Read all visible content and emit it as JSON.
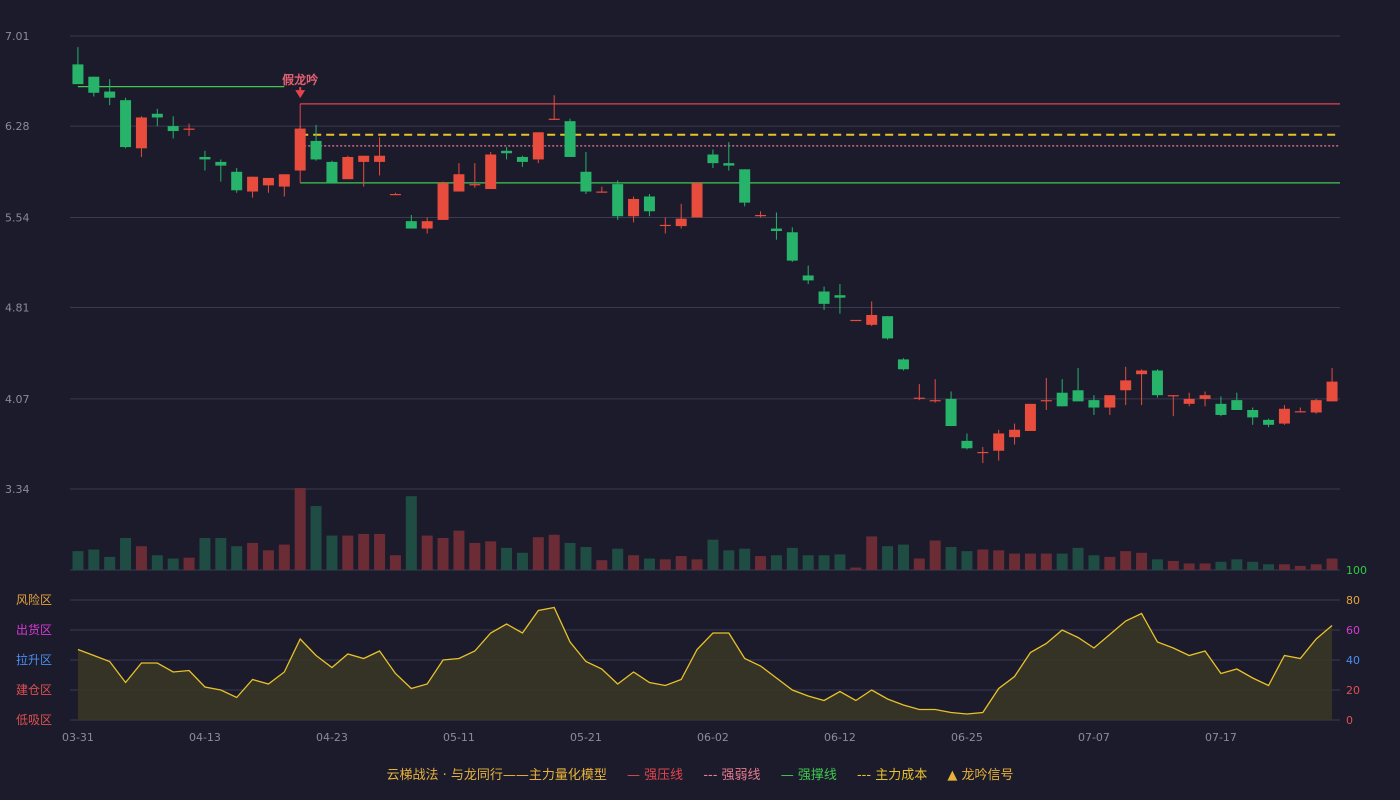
{
  "chart_data": {
    "type": "candlestick",
    "price_axis": {
      "ticks": [
        "7.01",
        "6.28",
        "5.54",
        "4.81",
        "4.07",
        "3.34"
      ],
      "ylim": [
        3.34,
        7.01
      ]
    },
    "x_ticks": [
      {
        "i": 0,
        "label": "03-31"
      },
      {
        "i": 8,
        "label": "04-13"
      },
      {
        "i": 16,
        "label": "04-23"
      },
      {
        "i": 24,
        "label": "05-11"
      },
      {
        "i": 32,
        "label": "05-21"
      },
      {
        "i": 40,
        "label": "06-02"
      },
      {
        "i": 48,
        "label": "06-12"
      },
      {
        "i": 56,
        "label": "06-25"
      },
      {
        "i": 64,
        "label": "07-07"
      },
      {
        "i": 72,
        "label": "07-17"
      }
    ],
    "candles": [
      {
        "o": 6.78,
        "h": 6.92,
        "l": 6.63,
        "c": 6.62
      },
      {
        "o": 6.68,
        "h": 6.68,
        "l": 6.52,
        "c": 6.55
      },
      {
        "o": 6.56,
        "h": 6.66,
        "l": 6.45,
        "c": 6.51
      },
      {
        "o": 6.49,
        "h": 6.51,
        "l": 6.1,
        "c": 6.11
      },
      {
        "o": 6.1,
        "h": 6.36,
        "l": 6.03,
        "c": 6.35
      },
      {
        "o": 6.38,
        "h": 6.42,
        "l": 6.28,
        "c": 6.35
      },
      {
        "o": 6.28,
        "h": 6.36,
        "l": 6.18,
        "c": 6.24
      },
      {
        "o": 6.25,
        "h": 6.3,
        "l": 6.2,
        "c": 6.26
      },
      {
        "o": 6.03,
        "h": 6.08,
        "l": 5.92,
        "c": 6.01
      },
      {
        "o": 5.99,
        "h": 6.01,
        "l": 5.83,
        "c": 5.96
      },
      {
        "o": 5.91,
        "h": 5.94,
        "l": 5.74,
        "c": 5.76
      },
      {
        "o": 5.75,
        "h": 5.87,
        "l": 5.7,
        "c": 5.87
      },
      {
        "o": 5.8,
        "h": 5.83,
        "l": 5.74,
        "c": 5.86
      },
      {
        "o": 5.79,
        "h": 5.84,
        "l": 5.71,
        "c": 5.89
      },
      {
        "o": 5.92,
        "h": 6.28,
        "l": 5.92,
        "c": 6.26
      },
      {
        "o": 6.16,
        "h": 6.29,
        "l": 6.0,
        "c": 6.01
      },
      {
        "o": 5.99,
        "h": 6.0,
        "l": 5.82,
        "c": 5.82
      },
      {
        "o": 5.85,
        "h": 6.04,
        "l": 5.85,
        "c": 6.03
      },
      {
        "o": 5.99,
        "h": 6.03,
        "l": 5.79,
        "c": 6.04
      },
      {
        "o": 5.99,
        "h": 6.19,
        "l": 5.88,
        "c": 6.04
      },
      {
        "o": 5.73,
        "h": 5.74,
        "l": 5.73,
        "c": 5.73
      },
      {
        "o": 5.51,
        "h": 5.56,
        "l": 5.49,
        "c": 5.45
      },
      {
        "o": 5.45,
        "h": 5.54,
        "l": 5.41,
        "c": 5.51
      },
      {
        "o": 5.52,
        "h": 5.83,
        "l": 5.52,
        "c": 5.82
      },
      {
        "o": 5.75,
        "h": 5.98,
        "l": 5.75,
        "c": 5.89
      },
      {
        "o": 5.8,
        "h": 5.98,
        "l": 5.78,
        "c": 5.81
      },
      {
        "o": 5.77,
        "h": 6.07,
        "l": 5.77,
        "c": 6.05
      },
      {
        "o": 6.08,
        "h": 6.11,
        "l": 6.01,
        "c": 6.06
      },
      {
        "o": 6.03,
        "h": 6.04,
        "l": 5.95,
        "c": 5.99
      },
      {
        "o": 6.01,
        "h": 6.01,
        "l": 5.98,
        "c": 6.23
      },
      {
        "o": 6.34,
        "h": 6.53,
        "l": 6.33,
        "c": 6.34
      },
      {
        "o": 6.32,
        "h": 6.34,
        "l": 6.03,
        "c": 6.03
      },
      {
        "o": 5.91,
        "h": 6.07,
        "l": 5.73,
        "c": 5.75
      },
      {
        "o": 5.75,
        "h": 5.79,
        "l": 5.75,
        "c": 5.75
      },
      {
        "o": 5.81,
        "h": 5.84,
        "l": 5.52,
        "c": 5.55
      },
      {
        "o": 5.55,
        "h": 5.71,
        "l": 5.5,
        "c": 5.69
      },
      {
        "o": 5.71,
        "h": 5.73,
        "l": 5.55,
        "c": 5.59
      },
      {
        "o": 5.48,
        "h": 5.54,
        "l": 5.41,
        "c": 5.48
      },
      {
        "o": 5.47,
        "h": 5.65,
        "l": 5.45,
        "c": 5.53
      },
      {
        "o": 5.54,
        "h": 5.82,
        "l": 5.54,
        "c": 5.82
      },
      {
        "o": 6.05,
        "h": 6.09,
        "l": 5.94,
        "c": 5.98
      },
      {
        "o": 5.98,
        "h": 6.15,
        "l": 5.92,
        "c": 5.96
      },
      {
        "o": 5.93,
        "h": 5.93,
        "l": 5.63,
        "c": 5.66
      },
      {
        "o": 5.55,
        "h": 5.59,
        "l": 5.54,
        "c": 5.56
      },
      {
        "o": 5.45,
        "h": 5.58,
        "l": 5.36,
        "c": 5.43
      },
      {
        "o": 5.42,
        "h": 5.46,
        "l": 5.18,
        "c": 5.19
      },
      {
        "o": 5.07,
        "h": 5.15,
        "l": 5.0,
        "c": 5.03
      },
      {
        "o": 4.94,
        "h": 4.98,
        "l": 4.79,
        "c": 4.84
      },
      {
        "o": 4.91,
        "h": 5.0,
        "l": 4.76,
        "c": 4.89
      },
      {
        "o": 4.71,
        "h": 4.71,
        "l": 4.71,
        "c": 4.71
      },
      {
        "o": 4.67,
        "h": 4.86,
        "l": 4.66,
        "c": 4.75
      },
      {
        "o": 4.74,
        "h": 4.74,
        "l": 4.55,
        "c": 4.56
      },
      {
        "o": 4.39,
        "h": 4.4,
        "l": 4.3,
        "c": 4.31
      },
      {
        "o": 4.08,
        "h": 4.19,
        "l": 4.06,
        "c": 4.08
      },
      {
        "o": 4.06,
        "h": 4.23,
        "l": 4.04,
        "c": 4.06
      },
      {
        "o": 4.07,
        "h": 4.13,
        "l": 3.85,
        "c": 3.85
      },
      {
        "o": 3.73,
        "h": 3.79,
        "l": 3.66,
        "c": 3.67
      },
      {
        "o": 3.64,
        "h": 3.68,
        "l": 3.55,
        "c": 3.64
      },
      {
        "o": 3.65,
        "h": 3.82,
        "l": 3.57,
        "c": 3.79
      },
      {
        "o": 3.76,
        "h": 3.87,
        "l": 3.7,
        "c": 3.82
      },
      {
        "o": 3.81,
        "h": 3.81,
        "l": 3.81,
        "c": 4.03
      },
      {
        "o": 4.06,
        "h": 4.24,
        "l": 3.98,
        "c": 4.06
      },
      {
        "o": 4.12,
        "h": 4.23,
        "l": 4.01,
        "c": 4.01
      },
      {
        "o": 4.14,
        "h": 4.32,
        "l": 4.06,
        "c": 4.05
      },
      {
        "o": 4.06,
        "h": 4.1,
        "l": 3.94,
        "c": 4.0
      },
      {
        "o": 4.0,
        "h": 4.1,
        "l": 3.94,
        "c": 4.1
      },
      {
        "o": 4.14,
        "h": 4.33,
        "l": 4.02,
        "c": 4.22
      },
      {
        "o": 4.27,
        "h": 4.31,
        "l": 4.02,
        "c": 4.3
      },
      {
        "o": 4.3,
        "h": 4.31,
        "l": 4.08,
        "c": 4.1
      },
      {
        "o": 4.1,
        "h": 4.1,
        "l": 3.93,
        "c": 4.1
      },
      {
        "o": 4.03,
        "h": 4.12,
        "l": 4.01,
        "c": 4.07
      },
      {
        "o": 4.07,
        "h": 4.13,
        "l": 4.01,
        "c": 4.1
      },
      {
        "o": 4.03,
        "h": 4.09,
        "l": 3.93,
        "c": 3.94
      },
      {
        "o": 4.06,
        "h": 4.12,
        "l": 3.98,
        "c": 3.98
      },
      {
        "o": 3.98,
        "h": 4.0,
        "l": 3.86,
        "c": 3.92
      },
      {
        "o": 3.9,
        "h": 3.91,
        "l": 3.84,
        "c": 3.86
      },
      {
        "o": 3.87,
        "h": 4.02,
        "l": 3.86,
        "c": 3.99
      },
      {
        "o": 3.97,
        "h": 4.0,
        "l": 3.96,
        "c": 3.97
      },
      {
        "o": 3.96,
        "h": 4.07,
        "l": 3.95,
        "c": 4.06
      },
      {
        "o": 4.05,
        "h": 4.32,
        "l": 4.05,
        "c": 4.21
      }
    ],
    "volume": [
      0.23,
      0.25,
      0.16,
      0.39,
      0.29,
      0.18,
      0.14,
      0.15,
      0.39,
      0.39,
      0.29,
      0.33,
      0.24,
      0.31,
      1.0,
      0.78,
      0.42,
      0.42,
      0.44,
      0.44,
      0.18,
      0.9,
      0.42,
      0.39,
      0.48,
      0.33,
      0.35,
      0.27,
      0.21,
      0.4,
      0.43,
      0.33,
      0.28,
      0.12,
      0.26,
      0.18,
      0.14,
      0.13,
      0.17,
      0.13,
      0.37,
      0.24,
      0.26,
      0.17,
      0.18,
      0.27,
      0.18,
      0.18,
      0.19,
      0.03,
      0.41,
      0.29,
      0.31,
      0.14,
      0.36,
      0.28,
      0.23,
      0.25,
      0.24,
      0.2,
      0.2,
      0.2,
      0.2,
      0.27,
      0.18,
      0.16,
      0.23,
      0.21,
      0.13,
      0.11,
      0.08,
      0.08,
      0.1,
      0.13,
      0.1,
      0.07,
      0.07,
      0.05,
      0.07,
      0.14
    ],
    "signal_marker": {
      "i": 14,
      "label": "假龙吟"
    },
    "levels": [
      {
        "name": "强压线",
        "price": 6.46,
        "from": 14,
        "color": "#e0444f",
        "style": "solid"
      },
      {
        "name": "主力成本",
        "price": 6.21,
        "from": 14,
        "color": "#e8c22a",
        "style": "dashed"
      },
      {
        "name": "强弱线",
        "price": 6.12,
        "from": 14,
        "color": "#e87a90",
        "style": "dotted"
      },
      {
        "name": "强撑线",
        "price": 5.82,
        "from": 14,
        "color": "#41c851",
        "style": "solid"
      },
      {
        "name": "强撑线",
        "price": 6.6,
        "from": 0,
        "to": 13,
        "color": "#41c851",
        "style": "solid"
      }
    ],
    "oscillator": {
      "ylim": [
        0,
        100
      ],
      "ticks": [
        "100",
        "80",
        "60",
        "40",
        "20",
        "0"
      ],
      "tick_colors": [
        "#2ecc40",
        "#e8a33a",
        "#d63ad6",
        "#4a8ff0",
        "#e05050",
        "#e05050"
      ],
      "zones": [
        {
          "label": "风险区",
          "value": 80,
          "color": "#e8a33a"
        },
        {
          "label": "出货区",
          "value": 60,
          "color": "#d63ad6"
        },
        {
          "label": "拉升区",
          "value": 40,
          "color": "#4a8ff0"
        },
        {
          "label": "建仓区",
          "value": 20,
          "color": "#e05050"
        },
        {
          "label": "低吸区",
          "value": 0,
          "color": "#e05050"
        }
      ],
      "values": [
        47,
        43,
        39,
        25,
        38,
        38,
        32,
        33,
        22,
        20,
        15,
        27,
        24,
        32,
        54,
        43,
        35,
        44,
        41,
        46,
        31,
        21,
        24,
        40,
        41,
        46,
        58,
        64,
        58,
        73,
        75,
        52,
        39,
        34,
        24,
        32,
        25,
        23,
        27,
        47,
        58,
        58,
        41,
        36,
        28,
        20,
        16,
        13,
        19,
        13,
        20,
        14,
        10,
        7,
        7,
        5,
        4,
        5,
        21,
        29,
        45,
        51,
        60,
        55,
        48,
        57,
        66,
        71,
        52,
        48,
        43,
        46,
        31,
        34,
        28,
        23,
        43,
        41,
        54,
        63
      ]
    },
    "colors": {
      "up": "#e74c3c",
      "down": "#27b36a",
      "vol_up": "#6b2c36",
      "vol_down": "#1f4d43",
      "osc_line": "#e8c22a"
    }
  },
  "legend": {
    "title": "云梯战法 · 与龙同行——主力量化模型",
    "items": [
      {
        "symbol": "—",
        "label": "强压线",
        "color": "#e0444f"
      },
      {
        "symbol": "---",
        "label": "强弱线",
        "color": "#e87a90"
      },
      {
        "symbol": "—",
        "label": "强撑线",
        "color": "#41c851"
      },
      {
        "symbol": "---",
        "label": "主力成本",
        "color": "#e8c22a"
      },
      {
        "symbol": "▲",
        "label": "龙吟信号",
        "color": "#e8b23a"
      }
    ]
  }
}
